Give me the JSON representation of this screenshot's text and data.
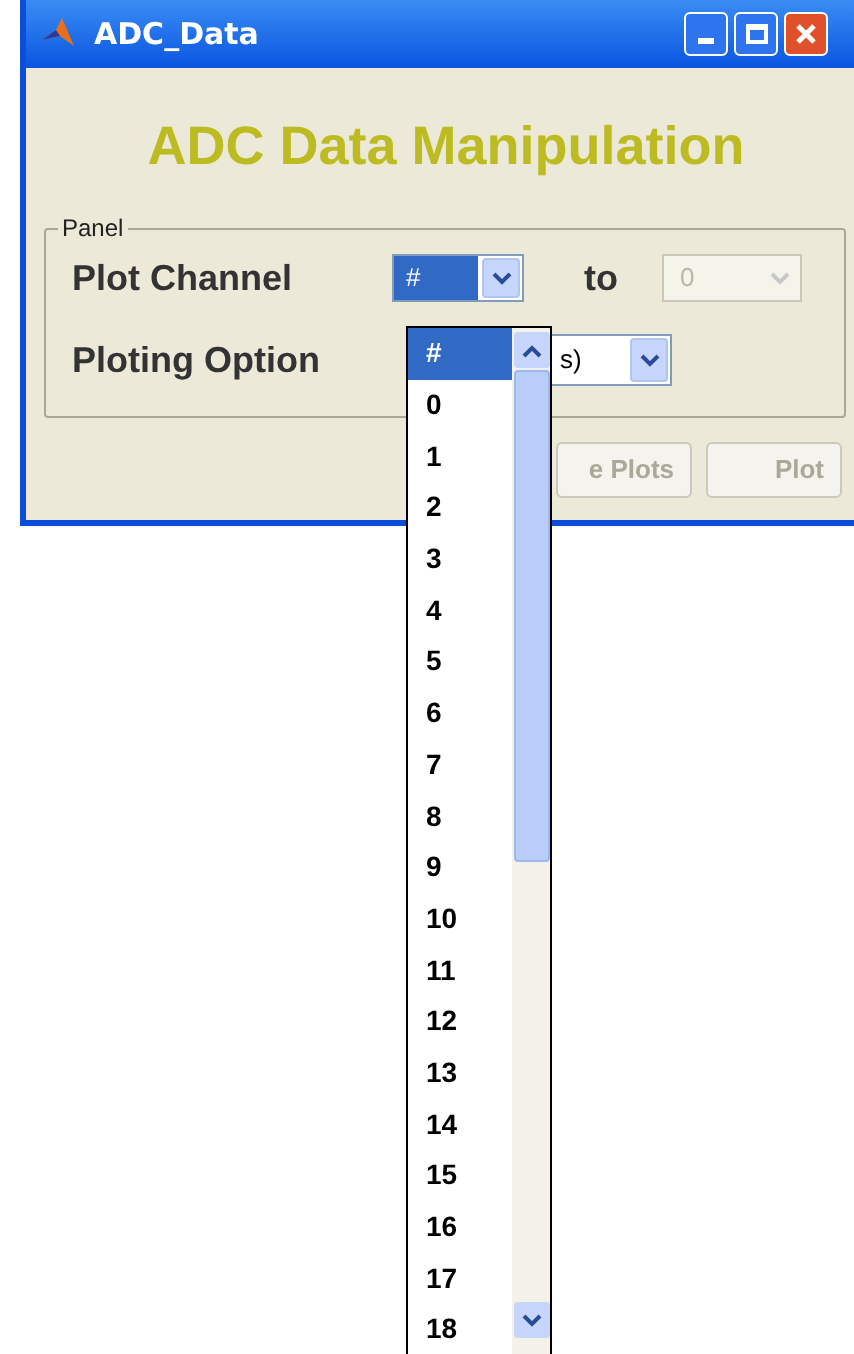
{
  "window": {
    "title": "ADC_Data"
  },
  "heading": "ADC Data Manipulation",
  "panel": {
    "title": "Panel",
    "plot_channel": {
      "label": "Plot Channel",
      "from_value": "#",
      "to_label": "to",
      "to_value": "0",
      "to_disabled": true
    },
    "ploting_option": {
      "label": "Ploting Option",
      "value": "s)"
    }
  },
  "buttons": [
    {
      "label": "e Plots",
      "disabled": true
    },
    {
      "label": "Plot",
      "disabled": true
    }
  ],
  "dropdown_list": {
    "items": [
      {
        "label": "#",
        "selected": true
      },
      {
        "label": "0",
        "selected": false
      },
      {
        "label": "1",
        "selected": false
      },
      {
        "label": "2",
        "selected": false
      },
      {
        "label": "3",
        "selected": false
      },
      {
        "label": "4",
        "selected": false
      },
      {
        "label": "5",
        "selected": false
      },
      {
        "label": "6",
        "selected": false
      },
      {
        "label": "7",
        "selected": false
      },
      {
        "label": "8",
        "selected": false
      },
      {
        "label": "9",
        "selected": false
      },
      {
        "label": "10",
        "selected": false
      },
      {
        "label": "11",
        "selected": false
      },
      {
        "label": "12",
        "selected": false
      },
      {
        "label": "13",
        "selected": false
      },
      {
        "label": "14",
        "selected": false
      },
      {
        "label": "15",
        "selected": false
      },
      {
        "label": "16",
        "selected": false
      },
      {
        "label": "17",
        "selected": false
      },
      {
        "label": "18",
        "selected": false
      }
    ]
  }
}
